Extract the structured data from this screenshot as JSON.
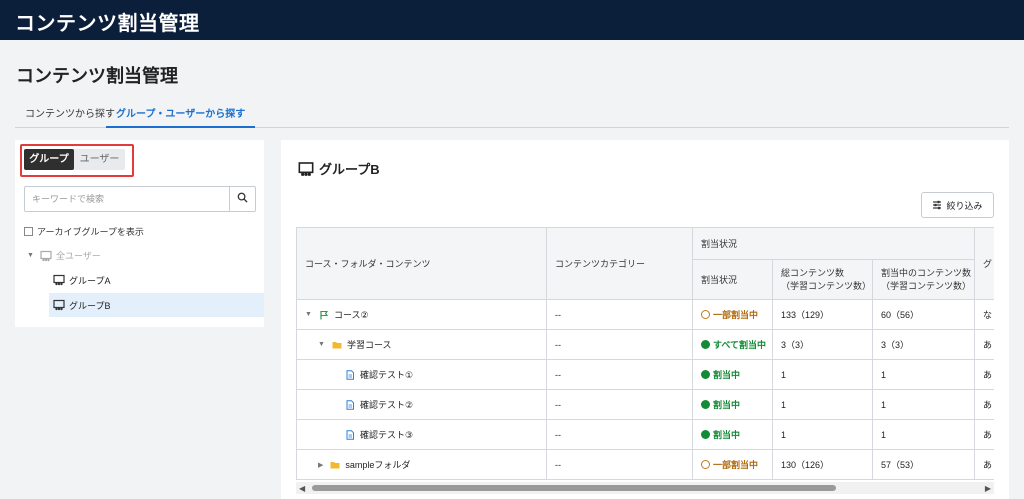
{
  "app": {
    "title": "コンテンツ割当管理"
  },
  "page": {
    "title": "コンテンツ割当管理"
  },
  "tabs": [
    {
      "label": "コンテンツから探す",
      "active": false
    },
    {
      "label": "グループ・ユーザーから探す",
      "active": true
    }
  ],
  "left": {
    "segment": {
      "group_label": "グループ",
      "user_label": "ユーザー",
      "selected": "グループ"
    },
    "search": {
      "placeholder": "キーワードで検索",
      "value": ""
    },
    "archive_label": "アーカイブグループを表示",
    "tree": {
      "root_label": "全ユーザー",
      "items": [
        {
          "label": "グループA",
          "selected": false
        },
        {
          "label": "グループB",
          "selected": true
        }
      ]
    }
  },
  "right": {
    "group_title": "グループB",
    "filter_label": "絞り込み",
    "table": {
      "headers": {
        "content": "コース・フォルダ・コンテンツ",
        "category": "コンテンツカテゴリー",
        "assign_status_group": "割当状況",
        "assign_status": "割当状況",
        "total": "総コンテンツ数\n（学習コンテンツ数）",
        "assigning": "割当中のコンテンツ数\n（学習コンテンツ数）",
        "last": "グ"
      },
      "rows": [
        {
          "name": "コース②",
          "indent": 0,
          "expand": "expanded",
          "icon": "flag-icon",
          "category": "--",
          "status": "一部割当中",
          "status_type": "partial",
          "total": "133（129）",
          "assigning": "60（56）",
          "last": "な"
        },
        {
          "name": "学習コース",
          "indent": 1,
          "expand": "expanded",
          "icon": "folder-icon",
          "category": "--",
          "status": "すべて割当中",
          "status_type": "ok",
          "total": "3（3）",
          "assigning": "3（3）",
          "last": "あ"
        },
        {
          "name": "確認テスト①",
          "indent": 2,
          "expand": "none",
          "icon": "document-icon",
          "category": "--",
          "status": "割当中",
          "status_type": "ok",
          "total": "1",
          "assigning": "1",
          "last": "あ"
        },
        {
          "name": "確認テスト②",
          "indent": 2,
          "expand": "none",
          "icon": "document-icon",
          "category": "--",
          "status": "割当中",
          "status_type": "ok",
          "total": "1",
          "assigning": "1",
          "last": "あ"
        },
        {
          "name": "確認テスト③",
          "indent": 2,
          "expand": "none",
          "icon": "document-icon",
          "category": "--",
          "status": "割当中",
          "status_type": "ok",
          "total": "1",
          "assigning": "1",
          "last": "あ"
        },
        {
          "name": "sampleフォルダ",
          "indent": 1,
          "expand": "collapsed",
          "icon": "folder-icon",
          "category": "--",
          "status": "一部割当中",
          "status_type": "partial",
          "total": "130（126）",
          "assigning": "57（53）",
          "last": "あ"
        }
      ]
    }
  },
  "colors": {
    "topbar": "#0b1f3a",
    "accent": "#1a6fd0",
    "highlight": "#e23b3b",
    "ok": "#138a36",
    "partial": "#b06a10",
    "selected_row": "#e3f0fb"
  }
}
